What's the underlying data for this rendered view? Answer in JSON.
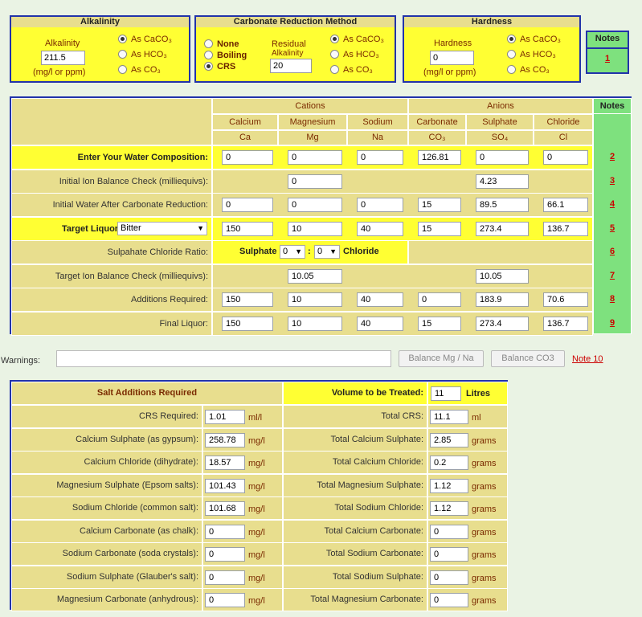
{
  "alkalinity": {
    "title": "Alkalinity",
    "label": "Alkalinity",
    "value": "211.5",
    "units": "(mg/l or ppm)",
    "options": [
      {
        "label": "As CaCO₃",
        "checked": true
      },
      {
        "label": "As HCO₃",
        "checked": false
      },
      {
        "label": "As CO₃",
        "checked": false
      }
    ]
  },
  "carbonate": {
    "title": "Carbonate Reduction Method",
    "methods": [
      {
        "label": "None",
        "checked": false
      },
      {
        "label": "Boiling",
        "checked": false
      },
      {
        "label": "CRS",
        "checked": true
      }
    ],
    "residual_label": "Residual",
    "residual_sub": "Alkalinity",
    "residual_value": "20",
    "options": [
      {
        "label": "As CaCO₃",
        "checked": true
      },
      {
        "label": "As HCO₃",
        "checked": false
      },
      {
        "label": "As CO₃",
        "checked": false
      }
    ]
  },
  "hardness": {
    "title": "Hardness",
    "label": "Hardness",
    "value": "0",
    "units": "(mg/l or ppm)",
    "options": [
      {
        "label": "As CaCO₃",
        "checked": true
      },
      {
        "label": "As HCO₃",
        "checked": false
      },
      {
        "label": "As CO₃",
        "checked": false
      }
    ]
  },
  "top_notes": {
    "title": "Notes",
    "link": "1"
  },
  "main": {
    "cations": "Cations",
    "anions": "Anions",
    "notes": "Notes",
    "ion_names": [
      "Calcium",
      "Magnesium",
      "Sodium",
      "Carbonate",
      "Sulphate",
      "Chloride"
    ],
    "ion_symbols": [
      "Ca",
      "Mg",
      "Na",
      "CO₃",
      "SO₄",
      "Cl"
    ],
    "rows": [
      {
        "label": "Enter Your Water Composition:",
        "values": [
          "0",
          "0",
          "0",
          "126.81",
          "0",
          "0"
        ],
        "note": "2",
        "bold": true,
        "yellow": true
      },
      {
        "label": "Initial Ion Balance Check (milliequivs):",
        "values": [
          "",
          "0",
          "",
          "",
          "4.23",
          ""
        ],
        "note": "3"
      },
      {
        "label": "Initial Water After Carbonate Reduction:",
        "values": [
          "0",
          "0",
          "0",
          "15",
          "89.5",
          "66.1"
        ],
        "note": "4"
      },
      {
        "label": "Target Liquor:",
        "select": "Bitter",
        "values": [
          "150",
          "10",
          "40",
          "15",
          "273.4",
          "136.7"
        ],
        "note": "5",
        "bold": true,
        "yellow": true
      },
      {
        "label": "Sulpahate Chloride Ratio:",
        "ratio": {
          "left": "Sulphate",
          "a": "0",
          "b": "0",
          "sep": ":",
          "right": "Chloride"
        },
        "note": "6"
      },
      {
        "label": "Target Ion Balance Check (milliequivs):",
        "values": [
          "",
          "10.05",
          "",
          "",
          "10.05",
          ""
        ],
        "note": "7"
      },
      {
        "label": "Additions Required:",
        "values": [
          "150",
          "10",
          "40",
          "0",
          "183.9",
          "70.6"
        ],
        "note": "8"
      },
      {
        "label": "Final Liquor:",
        "values": [
          "150",
          "10",
          "40",
          "15",
          "273.4",
          "136.7"
        ],
        "note": "9"
      }
    ]
  },
  "warnings": {
    "label": "Warnings:",
    "value": "",
    "btn_mg_na": "Balance Mg / Na",
    "btn_co3": "Balance CO3",
    "note": "Note 10"
  },
  "salts": {
    "title": "Salt Additions Required",
    "volume_label": "Volume to be Treated:",
    "volume_value": "11",
    "volume_unit": "Litres",
    "rows": [
      {
        "left": "CRS Required:",
        "lval": "1.01",
        "lunit": "ml/l",
        "right": "Total CRS:",
        "rval": "11.1",
        "runit": "ml"
      },
      {
        "left": "Calcium Sulphate (as gypsum):",
        "lval": "258.78",
        "lunit": "mg/l",
        "right": "Total Calcium Sulphate:",
        "rval": "2.85",
        "runit": "grams"
      },
      {
        "left": "Calcium Chloride (dihydrate):",
        "lval": "18.57",
        "lunit": "mg/l",
        "right": "Total Calcium Chloride:",
        "rval": "0.2",
        "runit": "grams"
      },
      {
        "left": "Magnesium Sulphate (Epsom salts):",
        "lval": "101.43",
        "lunit": "mg/l",
        "right": "Total Magnesium Sulphate:",
        "rval": "1.12",
        "runit": "grams"
      },
      {
        "left": "Sodium Chloride (common salt):",
        "lval": "101.68",
        "lunit": "mg/l",
        "right": "Total Sodium Chloride:",
        "rval": "1.12",
        "runit": "grams"
      },
      {
        "left": "Calcium Carbonate (as chalk):",
        "lval": "0",
        "lunit": "mg/l",
        "right": "Total Calcium Carbonate:",
        "rval": "0",
        "runit": "grams"
      },
      {
        "left": "Sodium Carbonate (soda crystals):",
        "lval": "0",
        "lunit": "mg/l",
        "right": "Total Sodium Carbonate:",
        "rval": "0",
        "runit": "grams"
      },
      {
        "left": "Sodium Sulphate (Glauber's salt):",
        "lval": "0",
        "lunit": "mg/l",
        "right": "Total Sodium Sulphate:",
        "rval": "0",
        "runit": "grams"
      },
      {
        "left": "Magnesium Carbonate (anhydrous):",
        "lval": "0",
        "lunit": "mg/l",
        "right": "Total Magnesium Carbonate:",
        "rval": "0",
        "runit": "grams"
      }
    ]
  },
  "colors": {
    "yellow": "#ffff33",
    "tan": "#e8de8e",
    "green": "#7ee17e",
    "border": "#2233aa",
    "note": "#cc0000",
    "bg": "#eaf3e4"
  }
}
